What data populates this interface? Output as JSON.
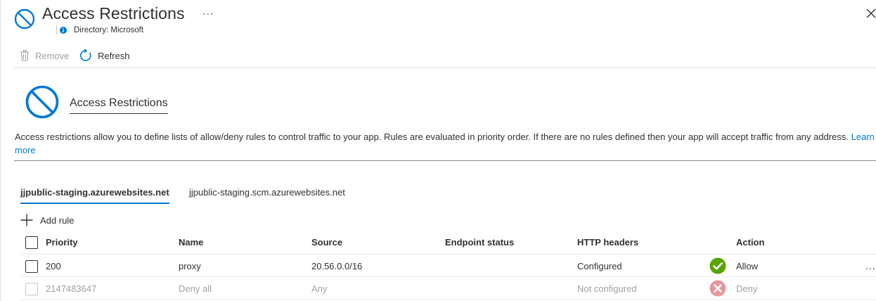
{
  "blade": {
    "title": "Access Restrictions",
    "more": "...",
    "subtitle": "Directory: Microsoft"
  },
  "toolbar": {
    "remove_label": "Remove",
    "refresh_label": "Refresh"
  },
  "section": {
    "title": "Access Restrictions",
    "description": "Access restrictions allow you to define lists of allow/deny rules to control traffic to your app. Rules are evaluated in priority order. If there are no rules defined then your app will accept traffic from any address.",
    "learn_more": "Learn more"
  },
  "tabs": [
    {
      "label": "jjpublic-staging.azurewebsites.net",
      "active": true
    },
    {
      "label": "jjpublic-staging.scm.azurewebsites.net",
      "active": false
    }
  ],
  "add_rule_label": "Add rule",
  "table": {
    "columns": [
      "Priority",
      "Name",
      "Source",
      "Endpoint status",
      "HTTP headers",
      "Action"
    ],
    "rows": [
      {
        "priority": "200",
        "name": "proxy",
        "source": "20.56.0.0/16",
        "endpoint_status": "",
        "http_headers": "Configured",
        "action": "Allow",
        "action_icon": "check-circle-icon",
        "disabled": false
      },
      {
        "priority": "2147483647",
        "name": "Deny all",
        "source": "Any",
        "endpoint_status": "",
        "http_headers": "Not configured",
        "action": "Deny",
        "action_icon": "x-circle-icon",
        "disabled": true
      }
    ],
    "row_more": "..."
  },
  "colors": {
    "accent": "#0078d4",
    "allow": "#57a300",
    "deny": "#e8979c"
  }
}
